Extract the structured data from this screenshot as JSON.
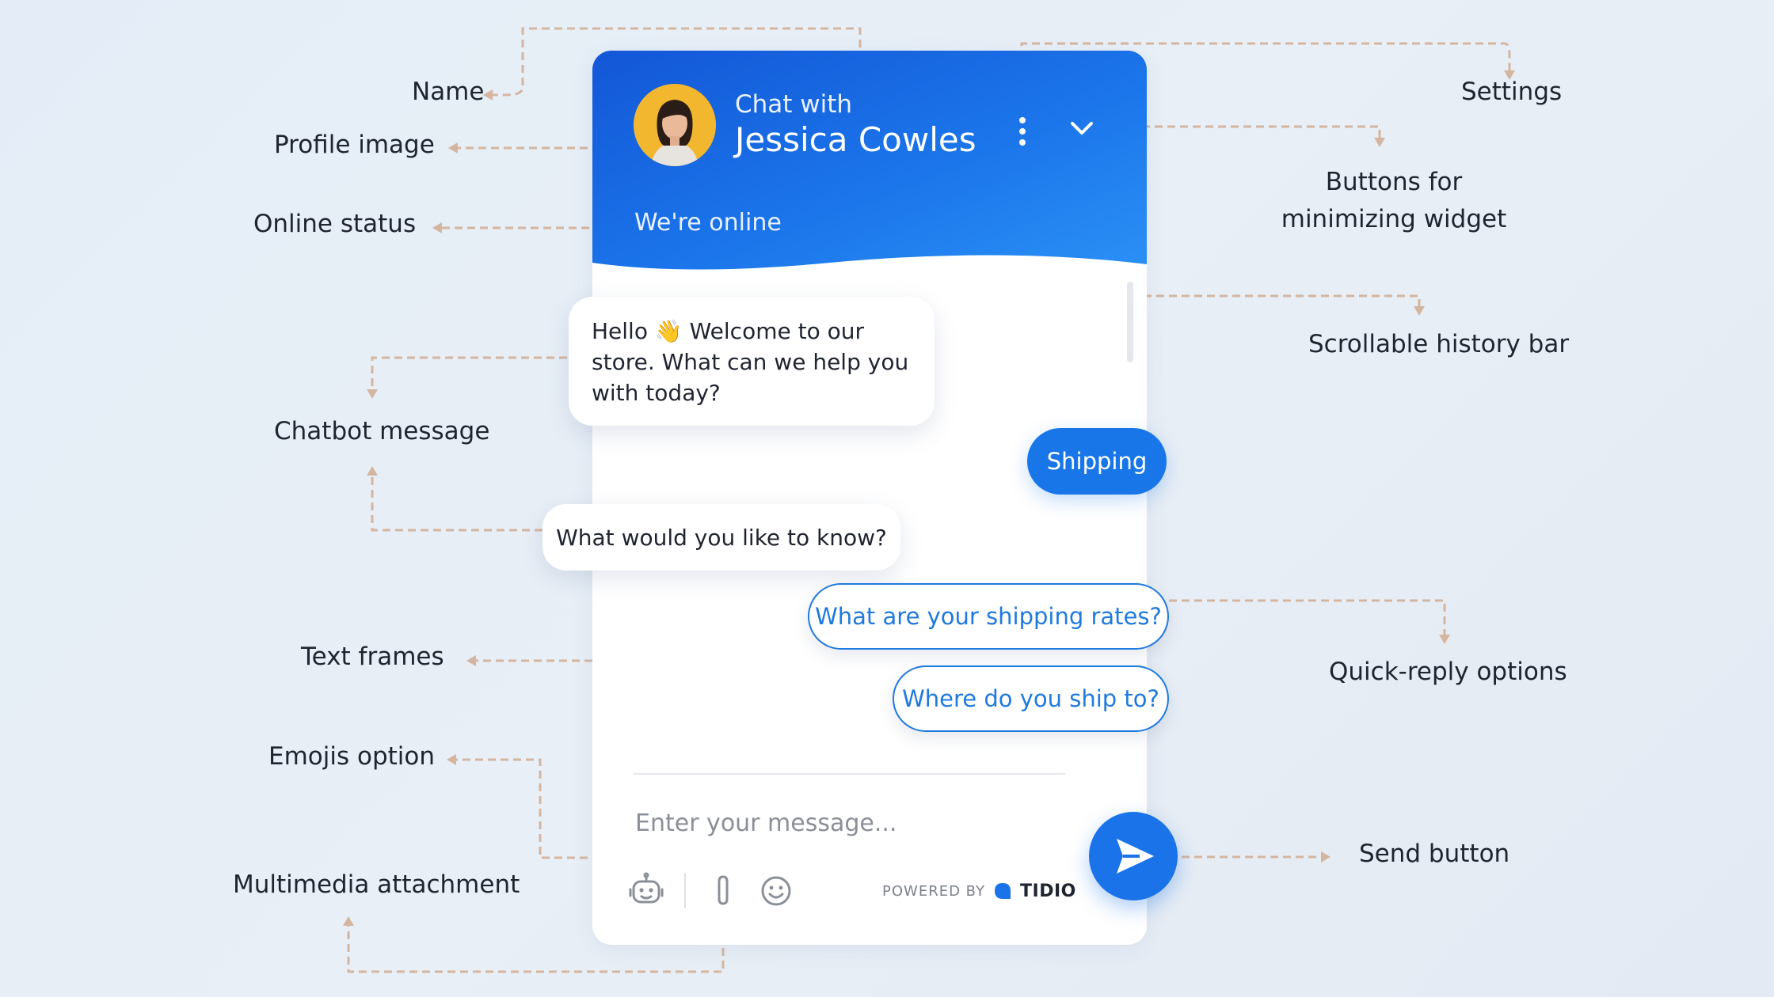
{
  "labels": {
    "name": "Name",
    "profile_image": "Profile image",
    "online_status": "Online status",
    "chatbot_message": "Chatbot message",
    "text_frames": "Text frames",
    "emojis_option": "Emojis option",
    "multimedia_attachment": "Multimedia attachment",
    "settings": "Settings",
    "minimize_line1": "Buttons for",
    "minimize_line2": "minimizing widget",
    "scrollable_history": "Scrollable history bar",
    "quick_reply": "Quick-reply options",
    "send_button": "Send button"
  },
  "widget": {
    "chat_with": "Chat with",
    "agent_name": "Jessica Cowles",
    "status": "We're online",
    "messages": {
      "greeting_line1": "Hello 👋 Welcome to our",
      "greeting_line2": "store. What can we help you",
      "greeting_line3": "with today?",
      "user_reply": "Shipping",
      "followup": "What would you like to know?"
    },
    "quick_replies": [
      "What are your shipping rates?",
      "Where do you ship to?"
    ],
    "input_placeholder": "Enter your message...",
    "powered_by": "POWERED BY",
    "brand": "TIDIO"
  },
  "colors": {
    "accent_blue": "#1a73e8",
    "connector": "#d4b6a0",
    "avatar_bg": "#f3b72f"
  }
}
